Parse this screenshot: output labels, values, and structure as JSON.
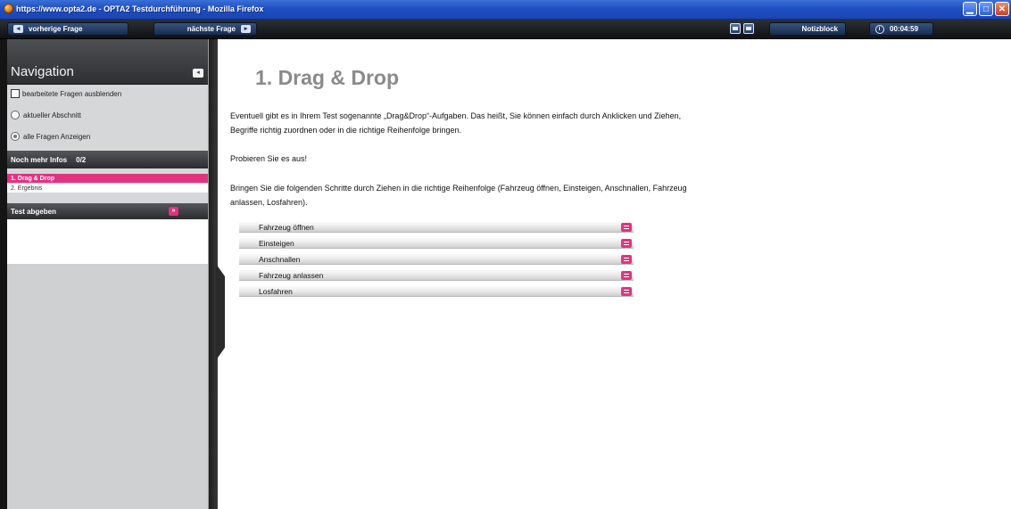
{
  "window": {
    "title": "https://www.opta2.de - OPTA2 Testdurchführung - Mozilla Firefox"
  },
  "toolbar": {
    "prev_label": "vorherige Frage",
    "next_label": "nächste Frage",
    "notiz_label": "Notizblock",
    "timer_value": "00:04:59"
  },
  "sidebar": {
    "title": "Navigation",
    "options": [
      {
        "type": "checkbox",
        "label": "bearbeitete Fragen ausblenden",
        "checked": false
      },
      {
        "type": "radio",
        "label": "aktueller Abschnitt",
        "selected": false
      },
      {
        "type": "radio",
        "label": "alle Fragen Anzeigen",
        "selected": true
      }
    ],
    "section_label": "Noch mehr Infos",
    "section_count": "0/2",
    "questions": [
      {
        "label": "1. Drag & Drop",
        "active": true
      },
      {
        "label": "2. Ergebnis",
        "active": false
      }
    ],
    "submit_label": "Test abgeben",
    "accent_color": "#e2337f"
  },
  "main": {
    "title": "1. Drag & Drop",
    "paragraph1": "Eventuell gibt es in Ihrem Test sogenannte „Drag&Drop“-Aufgaben. Das heißt, Sie können einfach durch Anklicken und Ziehen, Begriffe richtig zuordnen oder in die richtige Reihenfolge bringen.",
    "paragraph2": "Probieren Sie es aus!",
    "paragraph3": "Bringen Sie die folgenden Schritte durch Ziehen in die richtige Reihenfolge (Fahrzeug öffnen, Einsteigen, Anschnallen, Fahrzeug anlassen, Losfahren).",
    "drag_items": [
      "Fahrzeug öffnen",
      "Einsteigen",
      "Anschnallen",
      "Fahrzeug anlassen",
      "Losfahren"
    ]
  }
}
